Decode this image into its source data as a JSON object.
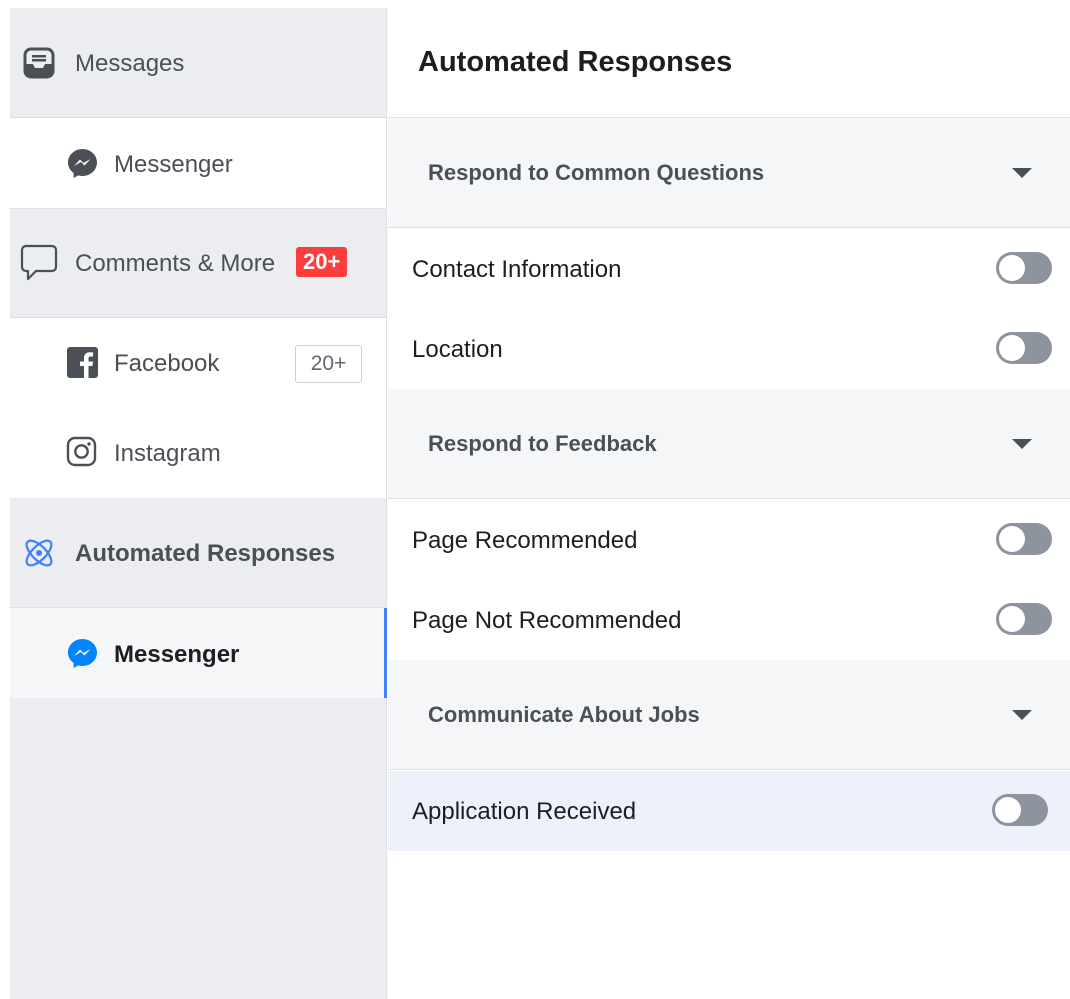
{
  "sidebar": {
    "messages": {
      "label": "Messages",
      "icon": "inbox-icon"
    },
    "messenger_1": {
      "label": "Messenger",
      "icon": "messenger-icon"
    },
    "comments": {
      "label": "Comments & More",
      "icon": "comment-bubble-icon",
      "badge": "20+"
    },
    "facebook": {
      "label": "Facebook",
      "icon": "facebook-icon",
      "badge": "20+"
    },
    "instagram": {
      "label": "Instagram",
      "icon": "instagram-icon"
    },
    "automated": {
      "label": "Automated Responses",
      "icon": "atom-icon"
    },
    "messenger_2": {
      "label": "Messenger",
      "icon": "messenger-icon",
      "active": true
    }
  },
  "main": {
    "title": "Automated Responses",
    "groups": [
      {
        "label": "Respond to Common Questions",
        "items": [
          {
            "label": "Contact Information",
            "enabled": false
          },
          {
            "label": "Location",
            "enabled": false
          }
        ]
      },
      {
        "label": "Respond to Feedback",
        "items": [
          {
            "label": "Page Recommended",
            "enabled": false
          },
          {
            "label": "Page Not Recommended",
            "enabled": false
          }
        ]
      },
      {
        "label": "Communicate About Jobs",
        "items": [
          {
            "label": "Application Received",
            "enabled": false,
            "highlighted": true
          }
        ]
      }
    ]
  },
  "colors": {
    "sidebar_bg": "#ebedf0",
    "active_accent": "#4080ff",
    "badge_red": "#fa3e3e",
    "toggle_off": "#8d949e",
    "messenger_active": "#0084ff"
  }
}
